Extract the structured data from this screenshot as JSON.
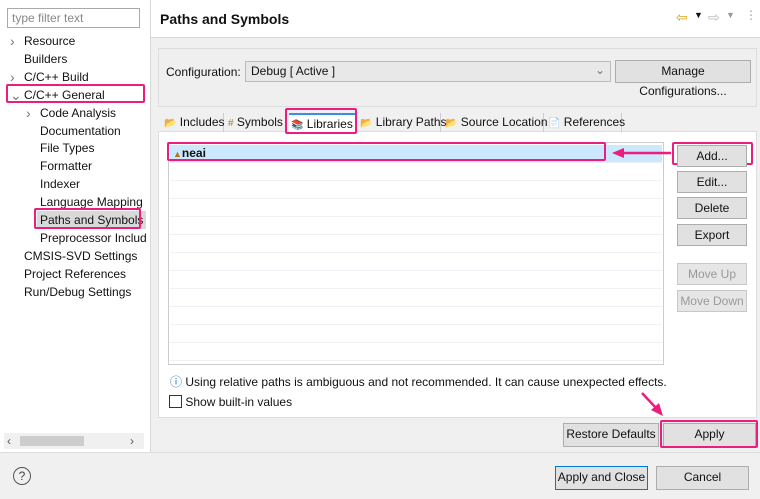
{
  "sidebar": {
    "filter_placeholder": "type filter text",
    "items": [
      {
        "label": "Resource",
        "chev": ">"
      },
      {
        "label": "Builders"
      },
      {
        "label": "C/C++ Build",
        "chev": ">"
      },
      {
        "label": "C/C++ General",
        "chev": "v"
      },
      {
        "label": "Code Analysis",
        "chev": ">"
      },
      {
        "label": "Documentation"
      },
      {
        "label": "File Types"
      },
      {
        "label": "Formatter"
      },
      {
        "label": "Indexer"
      },
      {
        "label": "Language Mapping"
      },
      {
        "label": "Paths and Symbols"
      },
      {
        "label": "Preprocessor Includ"
      },
      {
        "label": "CMSIS-SVD Settings"
      },
      {
        "label": "Project References"
      },
      {
        "label": "Run/Debug Settings"
      }
    ]
  },
  "header": {
    "title": "Paths and Symbols"
  },
  "config": {
    "label": "Configuration:",
    "value": "Debug  [ Active ]",
    "manage": "Manage Configurations..."
  },
  "tabs": [
    "Includes",
    "Symbols",
    "Libraries",
    "Library Paths",
    "Source Location",
    "References"
  ],
  "libraries": [
    "neai"
  ],
  "side_buttons": {
    "add": "Add...",
    "edit": "Edit...",
    "delete": "Delete",
    "export": "Export",
    "move_up": "Move Up",
    "move_down": "Move Down"
  },
  "info": "Using relative paths is ambiguous and not recommended. It can cause unexpected effects.",
  "show_builtin": "Show built-in values",
  "buttons": {
    "restore": "Restore Defaults",
    "apply": "Apply",
    "apply_close": "Apply and Close",
    "cancel": "Cancel"
  },
  "colors": {
    "highlight": "#ec1d7c",
    "selection": "#cce8ff"
  }
}
